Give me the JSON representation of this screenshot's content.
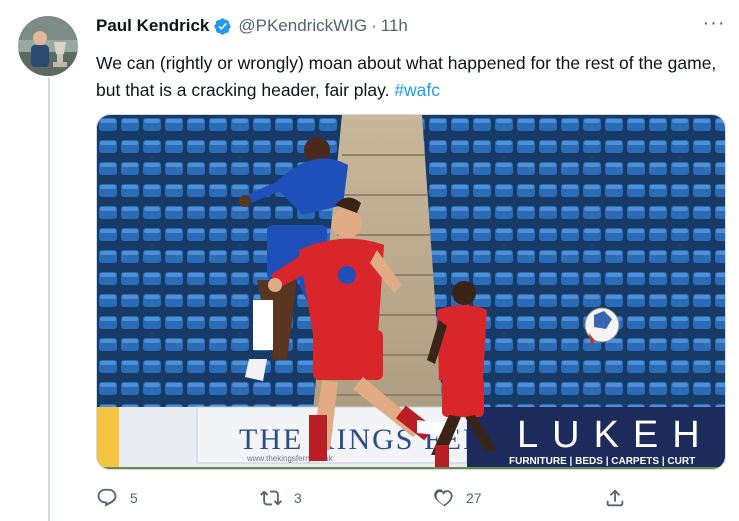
{
  "tweet": {
    "display_name": "Paul Kendrick",
    "handle": "@PKendrickWIG",
    "separator": "·",
    "time": "11h",
    "more_label": "···",
    "text": "We can (rightly or wrongly) moan about what happened for the rest of the game, but that is a cracking header, fair play. ",
    "hashtag": "#wafc"
  },
  "media": {
    "stadium_sign_text": "THE KINGS FERRY",
    "sponsor_board_text": "LUKEH",
    "sponsor_board_subtext": "FURNITURE | BEDS | CARPETS | CURT",
    "sign_small_text": "www.thekingsferry.co.uk"
  },
  "actions": {
    "replies": "5",
    "retweets": "3",
    "likes": "27"
  },
  "colors": {
    "verified": "#1d9bf0",
    "hashtag": "#1d9bf0",
    "muted": "#536471",
    "seat_blue": "#1f5fa8",
    "wigan_red": "#d8262b",
    "gillingham_blue": "#1f4fb8"
  },
  "icons": [
    "verified-badge-icon",
    "more-icon",
    "reply-icon",
    "retweet-icon",
    "like-icon",
    "share-icon"
  ]
}
